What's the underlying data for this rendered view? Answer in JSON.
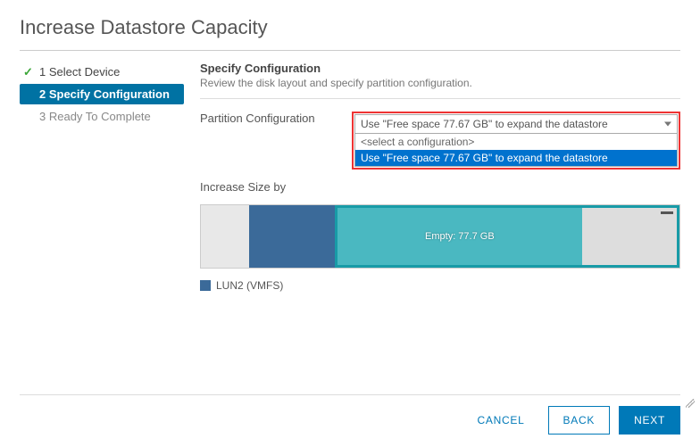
{
  "title": "Increase Datastore Capacity",
  "steps": {
    "s1": "1 Select Device",
    "s2": "2 Specify Configuration",
    "s3": "3 Ready To Complete"
  },
  "section": {
    "heading": "Specify Configuration",
    "desc": "Review the disk layout and specify partition configuration."
  },
  "form": {
    "partition_label": "Partition Configuration",
    "increase_label": "Increase Size by"
  },
  "dropdown": {
    "selected": "Use \"Free space 77.67 GB\" to expand the datastore",
    "placeholder": "<select a configuration>",
    "option1": "Use \"Free space 77.67 GB\" to expand the datastore"
  },
  "disk": {
    "empty_label": "Empty: 77.7 GB"
  },
  "legend": {
    "lun": "LUN2 (VMFS)"
  },
  "buttons": {
    "cancel": "CANCEL",
    "back": "BACK",
    "next": "NEXT"
  }
}
